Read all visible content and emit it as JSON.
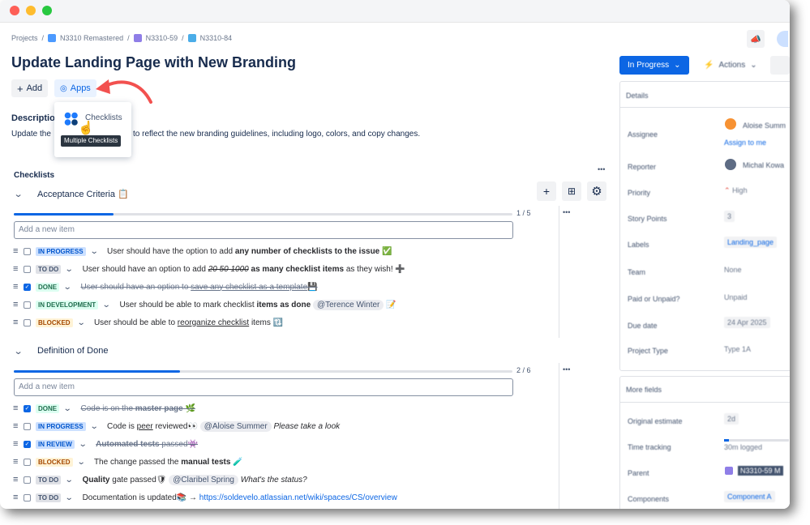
{
  "breadcrumb": {
    "projects": "Projects",
    "sep": "/",
    "project": "N3310 Remastered",
    "epic": "N3310-59",
    "issue": "N3310-84"
  },
  "issue": {
    "title": "Update Landing Page with New Branding"
  },
  "toolbar": {
    "add_label": "Add",
    "add_icon": "+",
    "apps_label": "Apps",
    "apps_icon": "◎"
  },
  "apps_menu": {
    "item_label": "Checklists",
    "tooltip": "Multiple Checklists"
  },
  "description": {
    "heading": "Description",
    "text_start": "Update the",
    "text_end": "to reflect the new branding guidelines, including logo, colors, and copy changes."
  },
  "checklists": {
    "heading": "Checklists",
    "more": "•••",
    "add_placeholder": "Add a new item",
    "groups": [
      {
        "title": "Acceptance Criteria",
        "emoji": "📋",
        "count": "1 / 5",
        "progress": 0.2,
        "items": [
          {
            "status": "IN PROGRESS",
            "checked": false,
            "t1": "User should have the option to add ",
            "t2": "any number of checklists to the issue",
            "emoji": "✅"
          },
          {
            "status": "TO DO",
            "checked": false,
            "t1": "User should have an option to add ",
            "t2": "20 50 1000",
            "t3": " as many checklist items",
            "t4": " as they wish!",
            "emoji": "➕"
          },
          {
            "status": "DONE",
            "checked": true,
            "t1": "User should have an option to ",
            "t2": "save any checklist as a template",
            "emoji": "💾"
          },
          {
            "status": "IN DEVELOPMENT",
            "checked": false,
            "t1": "User should be able to mark checklist ",
            "t2": "items as done",
            "mention": "@Terence Winter",
            "emoji": "📝"
          },
          {
            "status": "BLOCKED",
            "checked": false,
            "t1": "User should be able to ",
            "t2": "reorganize checklist",
            "t3": " items",
            "emoji": "🔃"
          }
        ]
      },
      {
        "title": "Definition of Done",
        "count": "2 / 6",
        "progress": 0.333,
        "items": [
          {
            "status": "DONE",
            "checked": true,
            "t1": "Code is on the ",
            "t2": "master page",
            "emoji": "🌿"
          },
          {
            "status": "IN PROGRESS",
            "checked": false,
            "t1": "Code is ",
            "t2": "peer",
            "t3": " reviewed",
            "emoji": "👀",
            "mention": "@Aloise Summer",
            "note": "Please take a look"
          },
          {
            "status": "IN REVIEW",
            "checked": true,
            "t1": "Automated tests",
            "t2": " passed",
            "emoji": "👾"
          },
          {
            "status": "BLOCKED",
            "checked": false,
            "t1": "The change passed the ",
            "t2": "manual tests",
            "emoji": "🧪"
          },
          {
            "status": "TO DO",
            "checked": false,
            "t1": "Quality",
            "t2": " gate passed",
            "emoji": "🛡",
            "mention": "@Claribel Spring",
            "note": "What's the status?"
          },
          {
            "status": "TO DO",
            "checked": false,
            "t1": "Documentation is updated",
            "emoji": "📚",
            "arrow": "→",
            "link": "https://soldevelo.atlassian.net/wiki/spaces/CS/overview"
          }
        ]
      }
    ]
  },
  "status_button": {
    "label": "In Progress",
    "chevron": "⌄"
  },
  "actions_button": {
    "label": "Actions",
    "chevron": "⌄"
  },
  "details": {
    "heading": "Details",
    "fields": [
      {
        "label": "Assignee",
        "value": "Aloise Summ",
        "sub": "Assign to me"
      },
      {
        "label": "Reporter",
        "value": "Michal Kowa"
      },
      {
        "label": "Priority",
        "value": "High"
      },
      {
        "label": "Story Points",
        "value": "3"
      },
      {
        "label": "Labels",
        "value": "Landing_page"
      },
      {
        "label": "Team",
        "value": "None"
      },
      {
        "label": "Paid or Unpaid?",
        "value": "Unpaid"
      },
      {
        "label": "Due date",
        "value": "24 Apr 2025"
      },
      {
        "label": "Project Type",
        "value": "Type 1A"
      }
    ]
  },
  "more_fields": {
    "heading": "More fields",
    "fields": [
      {
        "label": "Original estimate",
        "value": "2d"
      },
      {
        "label": "Time tracking",
        "value": "30m logged"
      },
      {
        "label": "Parent",
        "value": "N3310-59 M"
      },
      {
        "label": "Components",
        "value": "Component A"
      }
    ]
  },
  "colors": {
    "accent": "#0c66e4",
    "arrow": "#f2514f",
    "done": "#216e4e",
    "progress": "#0055cc",
    "blocked": "#a54800"
  }
}
